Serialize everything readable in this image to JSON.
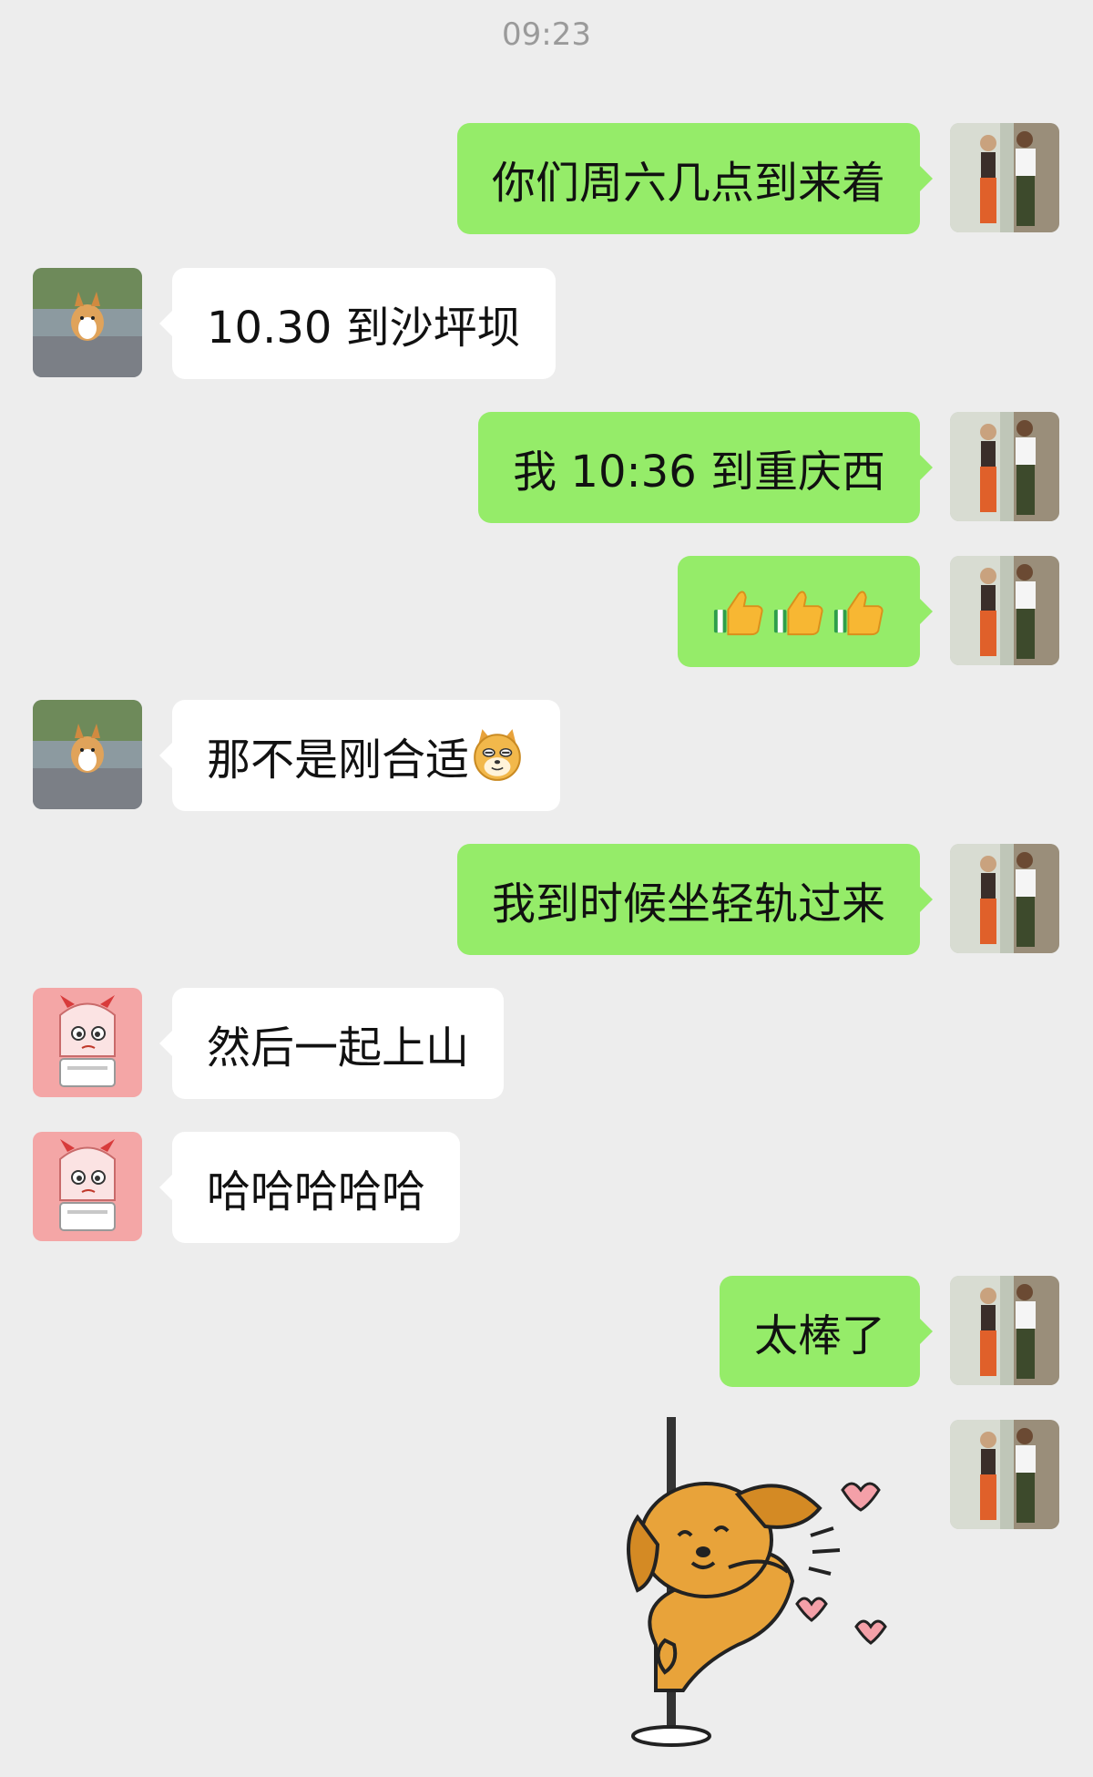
{
  "header": {
    "time": "09:23"
  },
  "messages": [
    {
      "text": "你们周六几点到来着"
    },
    {
      "text": "10.30 到沙坪坝"
    },
    {
      "text": "我 10:36 到重庆西"
    },
    {
      "text": "",
      "emoji": "thumbs-up-icon"
    },
    {
      "text": "那不是刚合适",
      "emoji": "doge-face-icon"
    },
    {
      "text": "我到时候坐轻轨过来"
    },
    {
      "text": "然后一起上山"
    },
    {
      "text": "哈哈哈哈哈"
    },
    {
      "text": "太棒了"
    }
  ],
  "sticker": {
    "name": "dancing-dog-sticker"
  },
  "colors": {
    "sent_bubble": "#95EC69",
    "received_bubble": "#FFFFFF",
    "background": "#EDEDED",
    "timestamp": "#9A9A9A"
  }
}
